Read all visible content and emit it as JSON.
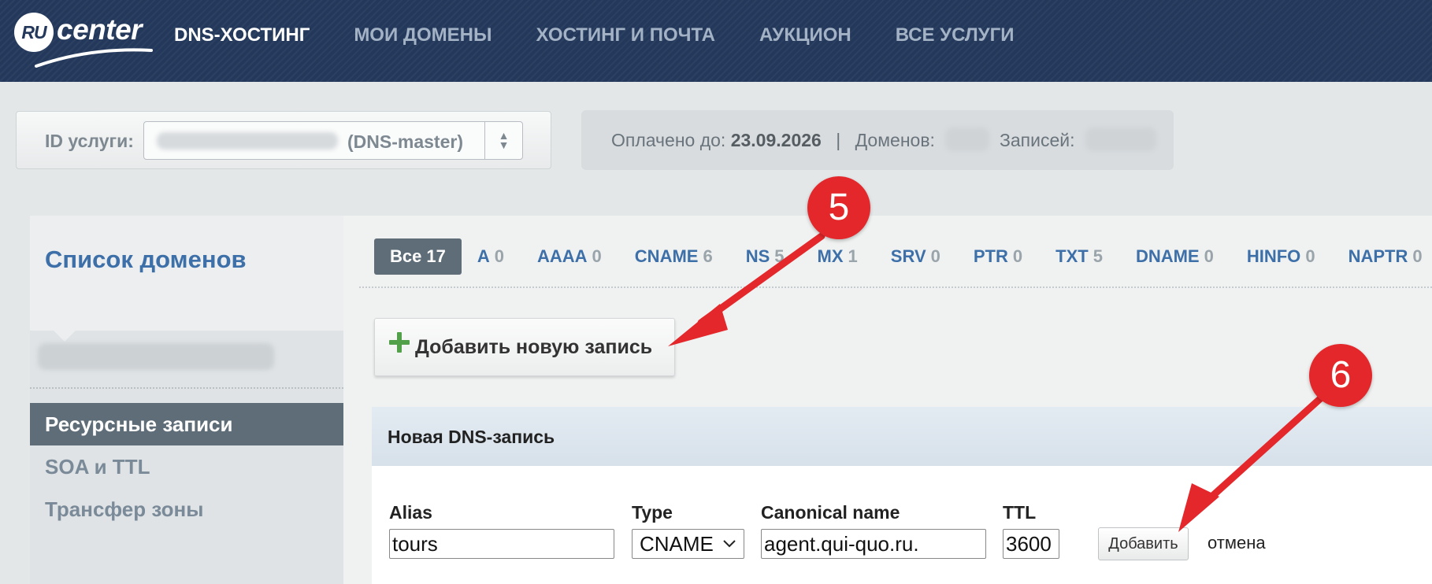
{
  "header": {
    "logo": {
      "ru": "RU",
      "center": "center"
    },
    "nav": [
      {
        "label": "DNS-ХОСТИНГ",
        "active": true
      },
      {
        "label": "МОИ ДОМЕНЫ"
      },
      {
        "label": "ХОСТИНГ И ПОЧТА"
      },
      {
        "label": "АУКЦИОН"
      },
      {
        "label": "ВСЕ УСЛУГИ"
      }
    ]
  },
  "service": {
    "label": "ID услуги:",
    "value_suffix": "(DNS-master)",
    "paid_label": "Оплачено до:",
    "paid_date": "23.09.2026",
    "separator": "|",
    "domains_label": "Доменов:",
    "records_label": "Записей:"
  },
  "sidebar": {
    "title": "Список доменов",
    "items": [
      {
        "label": "Ресурсные записи",
        "active": true
      },
      {
        "label": "SOA и TTL"
      },
      {
        "label": "Трансфер зоны"
      }
    ]
  },
  "filters": [
    {
      "label": "Все",
      "count": "17",
      "active": true
    },
    {
      "label": "A",
      "count": "0"
    },
    {
      "label": "AAAA",
      "count": "0"
    },
    {
      "label": "CNAME",
      "count": "6"
    },
    {
      "label": "NS",
      "count": "5"
    },
    {
      "label": "MX",
      "count": "1"
    },
    {
      "label": "SRV",
      "count": "0"
    },
    {
      "label": "PTR",
      "count": "0"
    },
    {
      "label": "TXT",
      "count": "5"
    },
    {
      "label": "DNAME",
      "count": "0"
    },
    {
      "label": "HINFO",
      "count": "0"
    },
    {
      "label": "NAPTR",
      "count": "0"
    }
  ],
  "add_record": {
    "label": "Добавить новую запись"
  },
  "new_record": {
    "title": "Новая DNS-запись",
    "fields": {
      "alias": {
        "label": "Alias",
        "value": "tours"
      },
      "type": {
        "label": "Type",
        "value": "CNAME"
      },
      "canonical": {
        "label": "Canonical name",
        "value": "agent.qui-quo.ru."
      },
      "ttl": {
        "label": "TTL",
        "value": "3600"
      }
    },
    "submit_label": "Добавить",
    "cancel_label": "отмена"
  },
  "annotations": {
    "step5": "5",
    "step6": "6"
  },
  "colors": {
    "header_bg": "#23385a",
    "link_blue": "#3d6fa8",
    "active_tab": "#5e6d78",
    "annotation_red": "#e3272b",
    "plus_green": "#52a14a"
  }
}
